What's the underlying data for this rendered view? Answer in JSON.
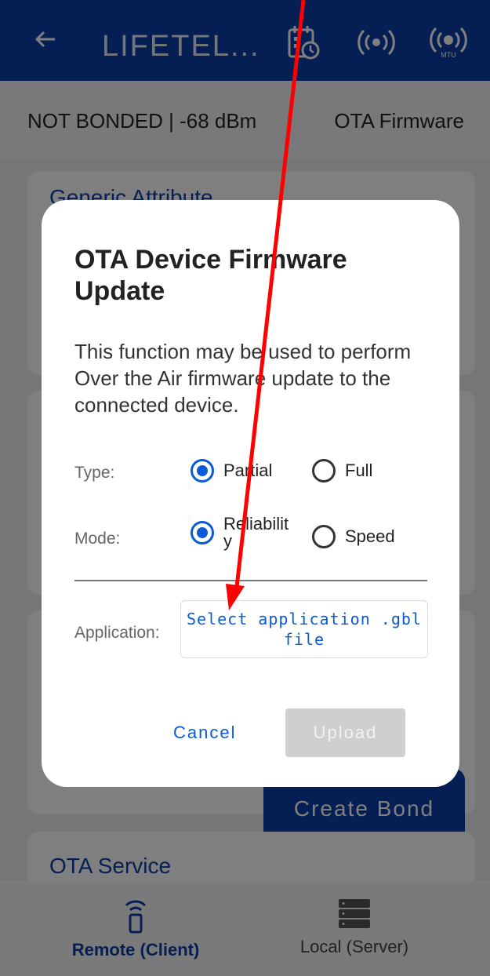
{
  "appbar": {
    "title": "LIFETEL...",
    "icons": [
      "back-arrow-icon",
      "calendar-clock-icon",
      "broadcast-icon",
      "mtu-icon"
    ],
    "mtu_label": "MTU",
    "color": "#0b3fa8"
  },
  "status": {
    "connection": "NOT BONDED | -68 dBm",
    "section": "OTA Firmware"
  },
  "behind": {
    "card1_header": "Generic Attribute",
    "create_bond": "Create Bond",
    "ota_service": "OTA Service"
  },
  "dialog": {
    "title": "OTA Device Firmware Update",
    "body": "This function may be used to perform Over the Air firmware update to the connected device.",
    "type": {
      "label": "Type:",
      "options": [
        {
          "label": "Partial",
          "selected": true
        },
        {
          "label": "Full",
          "selected": false
        }
      ]
    },
    "mode": {
      "label": "Mode:",
      "options": [
        {
          "label": "Reliabilit\ny",
          "selected": true
        },
        {
          "label": "Speed",
          "selected": false
        }
      ]
    },
    "application": {
      "label": "Application:",
      "button": "Select application .gbl file"
    },
    "cancel": "Cancel",
    "upload": "Upload"
  },
  "bottomnav": {
    "items": [
      {
        "label": "Remote (Client)",
        "icon": "remote-device-icon",
        "active": true
      },
      {
        "label": "Local (Server)",
        "icon": "server-icon",
        "active": false
      }
    ]
  },
  "annotation": {
    "color": "#ff0000",
    "icon": "red-arrow-icon"
  }
}
